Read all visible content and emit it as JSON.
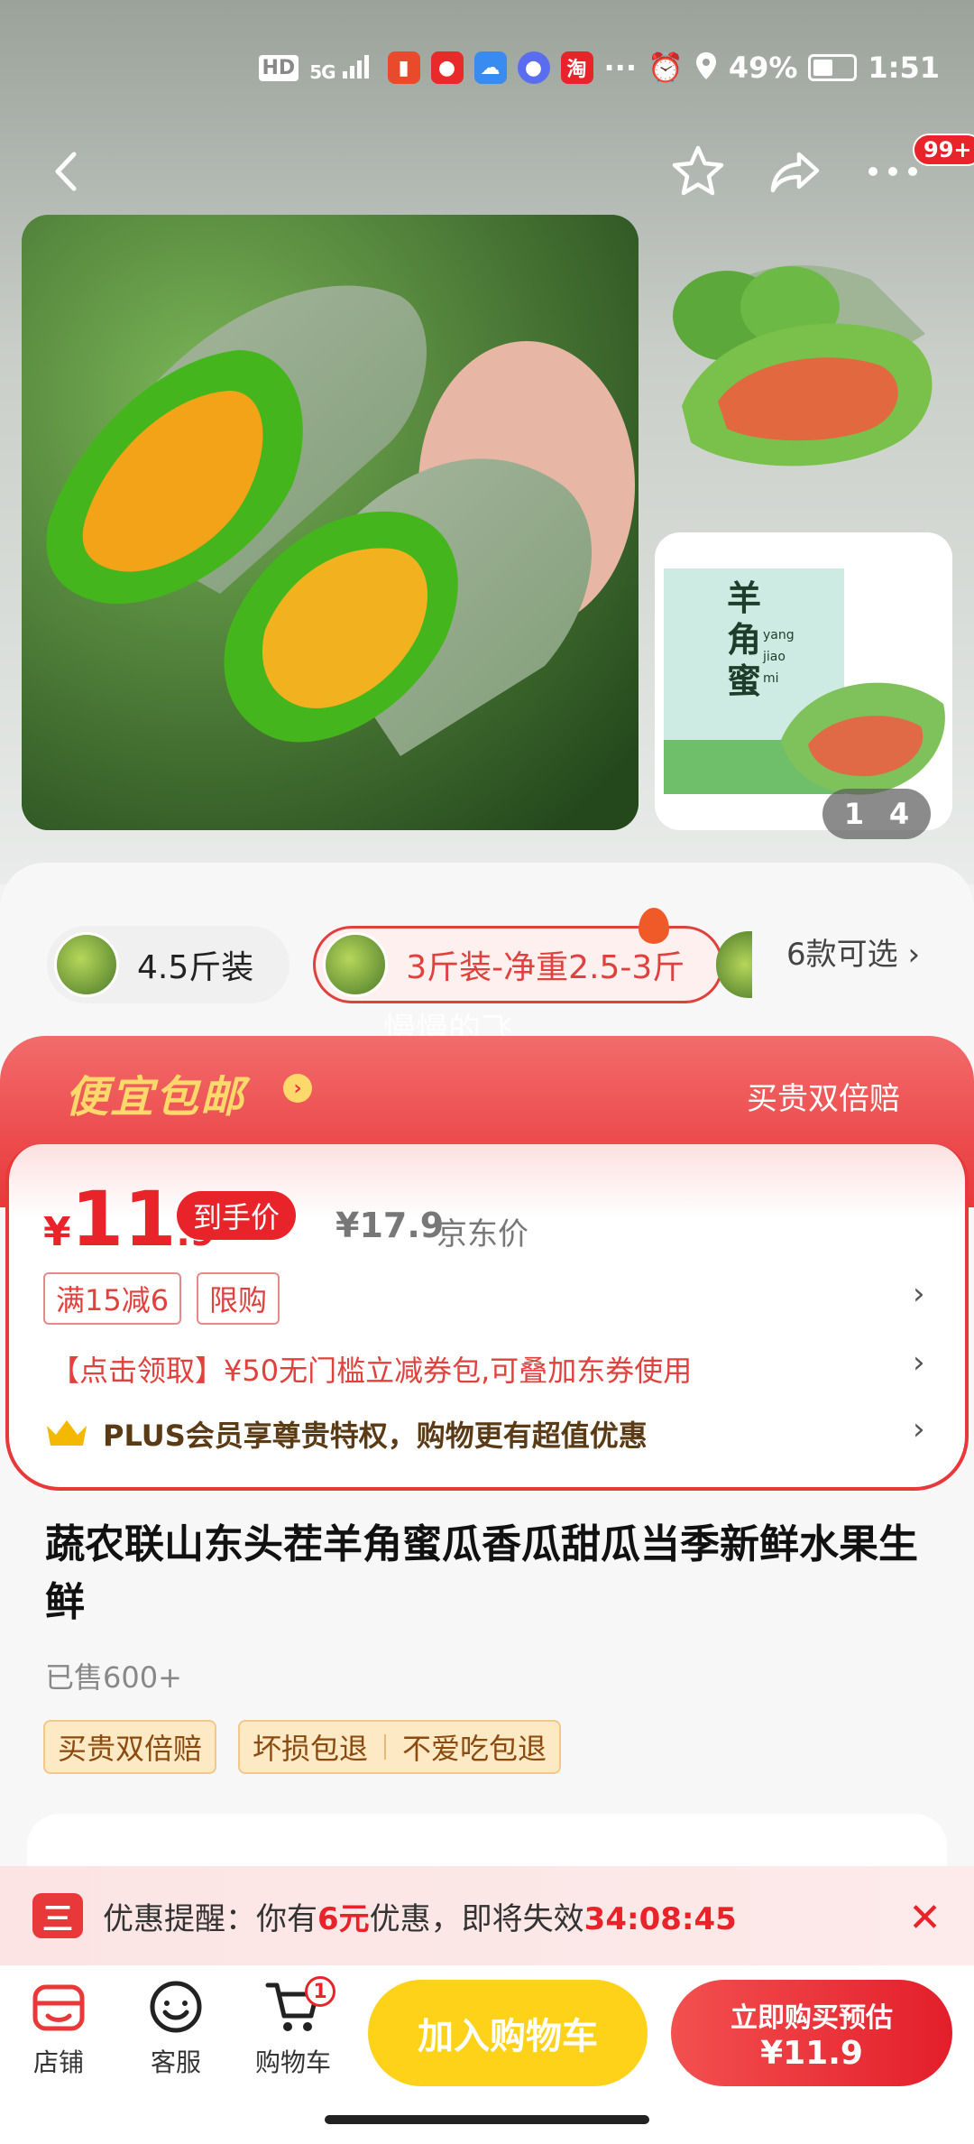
{
  "status_bar": {
    "hd": "HD",
    "signal": "5G",
    "battery": "49%",
    "time": "1:51",
    "battery_level": 0.49,
    "icons": [
      "hd-icon",
      "signal-icon",
      "alarm-icon",
      "location-icon",
      "battery-icon"
    ]
  },
  "nav": {
    "cart_count": "99+",
    "icons": [
      "back-icon",
      "star-icon",
      "share-icon",
      "more-icon"
    ]
  },
  "gallery": {
    "current_page": "1",
    "total_pages": "4",
    "box_text": "羊角蜜",
    "box_pinyin": [
      "yang",
      "jiao",
      "mi"
    ]
  },
  "variants": [
    {
      "label": "4.5斤装",
      "selected": false
    },
    {
      "label": "3斤装-净重2.5-3斤",
      "selected": true
    }
  ],
  "more_options": "6款可选 ›",
  "watermark": "慢慢的飞",
  "promo": {
    "title": "便宜包邮",
    "right_text": "买贵双倍赔"
  },
  "price": {
    "symbol": "¥",
    "integer": "11",
    "decimal": ".9",
    "label": "到手价",
    "jd_price": "¥17.9",
    "jd_label": "京东价",
    "tags": [
      "满15减6",
      "限购"
    ],
    "coupon_text": "【点击领取】¥50无门槛立减券包,可叠加东券使用",
    "plus_text": "PLUS会员享尊贵特权，购物更有超值优惠",
    "chevron": "›"
  },
  "product": {
    "title": "蔬农联山东头茬羊角蜜瓜香瓜甜瓜当季新鲜水果生鲜",
    "sold": "已售600+",
    "badges": [
      "买贵双倍赔",
      "坏损包退",
      "不爱吃包退"
    ]
  },
  "notice": {
    "icon_text": "三",
    "prefix": "优惠提醒：你有",
    "amount": "6元",
    "middle": "优惠，即将失效",
    "countdown": "34:08:45",
    "close": "✕"
  },
  "bottom_bar": {
    "store": "店铺",
    "service": "客服",
    "cart": "购物车",
    "cart_badge": "1",
    "add_to_cart": "加入购物车",
    "buy_line1": "立即购买预估",
    "buy_line2": "¥11.9"
  },
  "colors": {
    "accent_red": "#e8232a",
    "promo_gold": "#fcd96a",
    "cart_yellow": "#ffd21a"
  }
}
